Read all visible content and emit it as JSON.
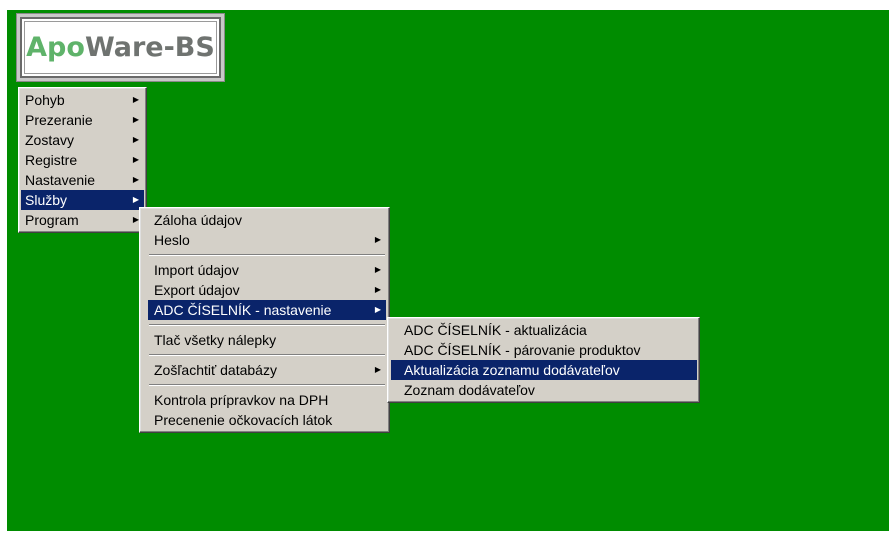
{
  "app": {
    "logo_part1": "Apo",
    "logo_part2": "Ware-BS"
  },
  "main_menu": {
    "items": [
      {
        "label": "Pohyb"
      },
      {
        "label": "Prezeranie"
      },
      {
        "label": "Zostavy"
      },
      {
        "label": "Registre"
      },
      {
        "label": "Nastavenie"
      },
      {
        "label": "Služby"
      },
      {
        "label": "Program"
      }
    ],
    "active_index": 5
  },
  "services_menu": {
    "items": [
      {
        "label": "Záloha údajov"
      },
      {
        "label": "Heslo"
      },
      {
        "label": "Import údajov"
      },
      {
        "label": "Export údajov"
      },
      {
        "label": "ADC ČÍSELNÍK - nastavenie"
      },
      {
        "label": "Tlač všetky nálepky"
      },
      {
        "label": "Zošľachtiť databázy"
      },
      {
        "label": "Kontrola prípravkov na DPH"
      },
      {
        "label": "Precenenie očkovacích látok"
      }
    ],
    "active_index": 4
  },
  "adc_menu": {
    "items": [
      {
        "label": "ADC ČÍSELNÍK - aktualizácia"
      },
      {
        "label": "ADC ČÍSELNÍK - párovanie produktov"
      },
      {
        "label": "Aktualizácia zoznamu dodávateľov"
      },
      {
        "label": "Zoznam dodávateľov"
      }
    ],
    "active_index": 2
  },
  "colors": {
    "desktop_bg": "#008c00",
    "menu_bg": "#d4d0c8",
    "highlight": "#0a246a"
  },
  "icons": {
    "submenu_arrow": "▸"
  }
}
